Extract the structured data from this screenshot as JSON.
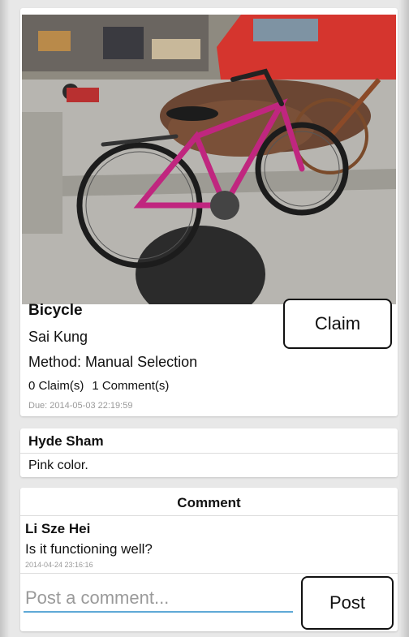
{
  "item": {
    "title": "Bicycle",
    "location": "Sai Kung",
    "method": "Method: Manual Selection",
    "claims": "0 Claim(s)",
    "comments": "1 Comment(s)",
    "due": "Due: 2014-05-03 22:19:59",
    "claim_label": "Claim"
  },
  "note": {
    "owner": "Hyde Sham",
    "text": "Pink color."
  },
  "comment_section": {
    "header": "Comment",
    "comments": [
      {
        "author": "Li Sze Hei",
        "text": "Is it functioning well?",
        "time": "2014-04-24 23:16:16"
      }
    ],
    "input_placeholder": "Post a comment...",
    "post_label": "Post"
  },
  "colors": {
    "accent": "#5fa9d6",
    "bike_frame": "#c0267f"
  }
}
